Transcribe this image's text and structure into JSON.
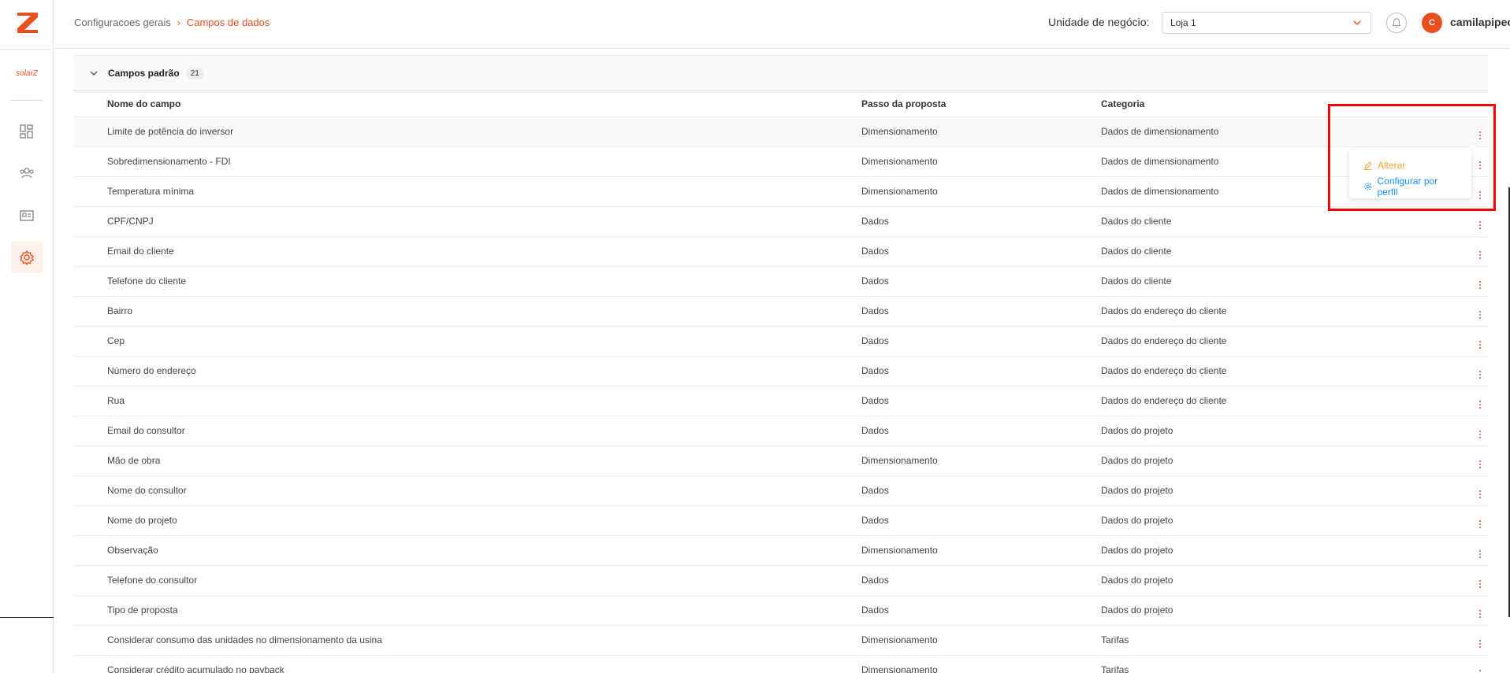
{
  "brand": {
    "name": "solarZ",
    "accent": "#e8501f"
  },
  "breadcrumb": {
    "home": "Configuracoes gerais",
    "separator": "›",
    "current": "Campos de dados"
  },
  "header": {
    "unit_label": "Unidade de negócio:",
    "unit_value": "Loja 1",
    "avatar_initial": "C",
    "username": "camilapipechat"
  },
  "section": {
    "title": "Campos padrão",
    "count": "21"
  },
  "columns": {
    "name": "Nome do campo",
    "step": "Passo da proposta",
    "category": "Categoria"
  },
  "rows": [
    {
      "name": "Limite de potência do inversor",
      "step": "Dimensionamento",
      "category": "Dados de dimensionamento"
    },
    {
      "name": "Sobredimensionamento - FDI",
      "step": "Dimensionamento",
      "category": "Dados de dimensionamento"
    },
    {
      "name": "Temperatura mínima",
      "step": "Dimensionamento",
      "category": "Dados de dimensionamento"
    },
    {
      "name": "CPF/CNPJ",
      "step": "Dados",
      "category": "Dados do cliente"
    },
    {
      "name": "Email do cliente",
      "step": "Dados",
      "category": "Dados do cliente"
    },
    {
      "name": "Telefone do cliente",
      "step": "Dados",
      "category": "Dados do cliente"
    },
    {
      "name": "Bairro",
      "step": "Dados",
      "category": "Dados do endereço do cliente"
    },
    {
      "name": "Cep",
      "step": "Dados",
      "category": "Dados do endereço do cliente"
    },
    {
      "name": "Número do endereço",
      "step": "Dados",
      "category": "Dados do endereço do cliente"
    },
    {
      "name": "Rua",
      "step": "Dados",
      "category": "Dados do endereço do cliente"
    },
    {
      "name": "Email do consultor",
      "step": "Dados",
      "category": "Dados do projeto"
    },
    {
      "name": "Mão de obra",
      "step": "Dimensionamento",
      "category": "Dados do projeto"
    },
    {
      "name": "Nome do consultor",
      "step": "Dados",
      "category": "Dados do projeto"
    },
    {
      "name": "Nome do projeto",
      "step": "Dados",
      "category": "Dados do projeto"
    },
    {
      "name": "Observação",
      "step": "Dimensionamento",
      "category": "Dados do projeto"
    },
    {
      "name": "Telefone do consultor",
      "step": "Dados",
      "category": "Dados do projeto"
    },
    {
      "name": "Tipo de proposta",
      "step": "Dados",
      "category": "Dados do projeto"
    },
    {
      "name": "Considerar consumo das unidades no dimensionamento da usina",
      "step": "Dimensionamento",
      "category": "Tarifas"
    },
    {
      "name": "Considerar crédito acumulado no payback",
      "step": "Dimensionamento",
      "category": "Tarifas"
    }
  ],
  "dropdown": {
    "alterar": "Alterar",
    "configurar": "Configurar por perfil"
  },
  "icons": {
    "logo": "z-logo-icon",
    "dashboard": "dashboard-icon",
    "users": "users-icon",
    "proposals": "document-icon",
    "settings": "gear-icon",
    "bell": "bell-icon",
    "chevron": "chevron-down-icon",
    "kebab": "kebab-icon",
    "edit": "pencil-icon"
  },
  "colors": {
    "primary": "#e8501f",
    "edit": "#f5a623",
    "link": "#1890ff",
    "highlight": "#ff0000"
  }
}
